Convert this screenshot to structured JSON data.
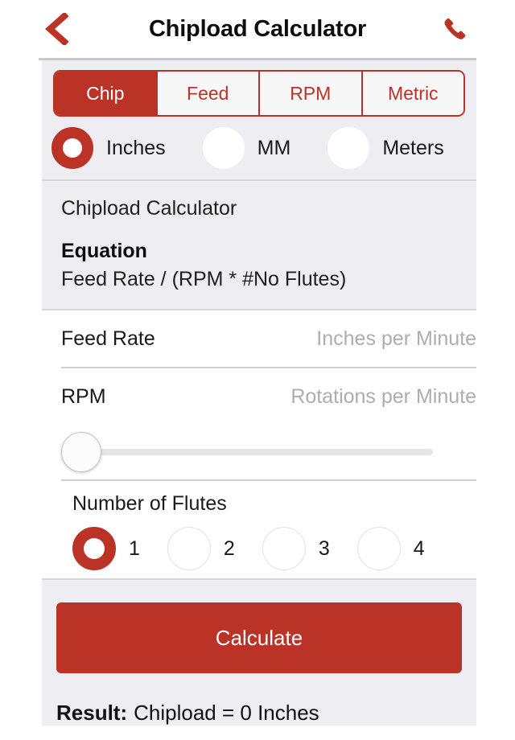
{
  "header": {
    "title": "Chipload Calculator",
    "back_icon": "back-chevron-icon",
    "call_icon": "phone-icon"
  },
  "tabs": {
    "items": [
      {
        "label": "Chip",
        "active": true
      },
      {
        "label": "Feed",
        "active": false
      },
      {
        "label": "RPM",
        "active": false
      },
      {
        "label": "Metric",
        "active": false
      }
    ]
  },
  "units": {
    "options": [
      {
        "label": "Inches",
        "selected": true
      },
      {
        "label": "MM",
        "selected": false
      },
      {
        "label": "Meters",
        "selected": false
      }
    ]
  },
  "equation": {
    "caption": "Chipload Calculator",
    "heading": "Equation",
    "formula": "Feed Rate / (RPM * #No Flutes)"
  },
  "inputs": {
    "feed_rate": {
      "label": "Feed Rate",
      "value": "",
      "placeholder": "Inches per Minute"
    },
    "rpm": {
      "label": "RPM",
      "value": "",
      "placeholder": "Rotations per Minute"
    },
    "rpm_slider": {
      "value": 0,
      "min": 0,
      "max": 100
    }
  },
  "flutes": {
    "title": "Number of Flutes",
    "options": [
      {
        "label": "1",
        "selected": true
      },
      {
        "label": "2",
        "selected": false
      },
      {
        "label": "3",
        "selected": false
      },
      {
        "label": "4",
        "selected": false
      }
    ]
  },
  "actions": {
    "calculate_label": "Calculate"
  },
  "result": {
    "label": "Result:",
    "value": "Chipload = 0 Inches"
  },
  "colors": {
    "brand_red": "#bb3326",
    "panel_gray": "#eeeef2",
    "text_dark": "#1a1a1a",
    "placeholder_gray": "#adadad"
  }
}
